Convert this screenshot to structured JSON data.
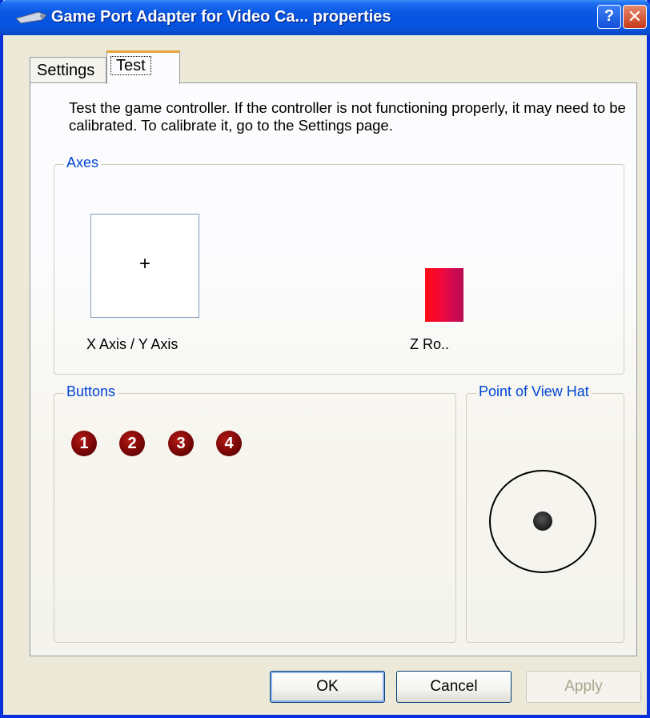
{
  "window": {
    "title": "Game Port Adapter for Video Ca... properties",
    "title_icon": "joystick-icon",
    "help_glyph": "?",
    "close_glyph": "✕"
  },
  "tabs": [
    {
      "label": "Settings",
      "selected": false
    },
    {
      "label": "Test",
      "selected": true
    }
  ],
  "description": "Test the game controller.  If the controller is not functioning properly, it may need to be calibrated.  To calibrate it, go to the Settings page.",
  "axes": {
    "group_label": "Axes",
    "xy_label": "X Axis / Y Axis",
    "crosshair": "+",
    "z_label": "Z Ro.."
  },
  "buttons": {
    "group_label": "Buttons",
    "items": [
      "1",
      "2",
      "3",
      "4"
    ]
  },
  "pov": {
    "group_label": "Point of View Hat"
  },
  "dialog_buttons": {
    "ok": "OK",
    "cancel": "Cancel",
    "apply": "Apply",
    "apply_enabled": false
  },
  "colors": {
    "titlebar": "#0554e2",
    "group_label": "#0046d5",
    "button_circle": "#7a0706",
    "z_bar": "#e8083c",
    "tab_highlight": "#e7a53a"
  }
}
